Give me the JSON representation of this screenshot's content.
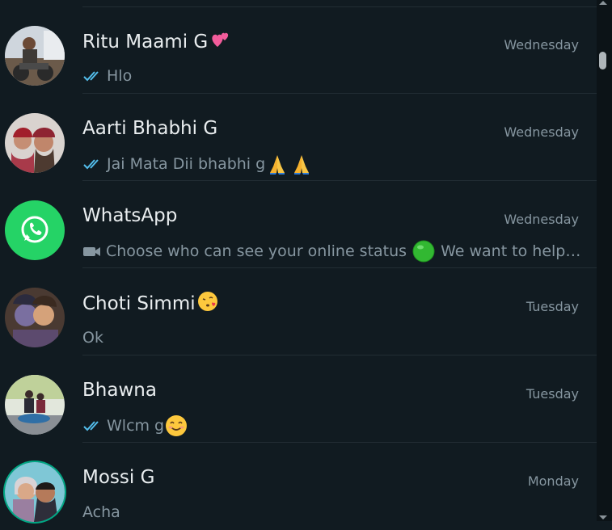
{
  "colors": {
    "background": "#111b21",
    "name_text": "#e9edef",
    "secondary_text": "#8696a0",
    "read_tick": "#53bdeb",
    "whatsapp_green": "#25d366",
    "divider": "#222d34"
  },
  "chats": [
    {
      "name": "Ritu Maami G",
      "name_emoji": "two-hearts-emoji",
      "time": "Wednesday",
      "status_icon": "double-check-read-icon",
      "preview": "Hlo",
      "preview_emoji": ""
    },
    {
      "name": "Aarti Bhabhi G",
      "name_emoji": "",
      "time": "Wednesday",
      "status_icon": "double-check-read-icon",
      "preview": "Jai Mata Dii bhabhi g",
      "preview_emoji": "folded-hands-emoji x2"
    },
    {
      "name": "WhatsApp",
      "name_emoji": "",
      "time": "Wednesday",
      "status_icon": "video-camera-icon",
      "preview": "Choose who can see your online status",
      "preview_emoji": "green-circle-emoji",
      "preview_tail": "We want to help…"
    },
    {
      "name": "Choti Simmi",
      "name_emoji": "face-blowing-kiss-emoji",
      "time": "Tuesday",
      "status_icon": "",
      "preview": "Ok",
      "preview_emoji": ""
    },
    {
      "name": "Bhawna",
      "name_emoji": "",
      "time": "Tuesday",
      "status_icon": "double-check-read-icon",
      "preview": "Wlcm g",
      "preview_emoji": "smiling-face-emoji"
    },
    {
      "name": "Mossi G",
      "name_emoji": "",
      "time": "Monday",
      "status_icon": "",
      "preview": "Acha",
      "preview_emoji": ""
    }
  ]
}
